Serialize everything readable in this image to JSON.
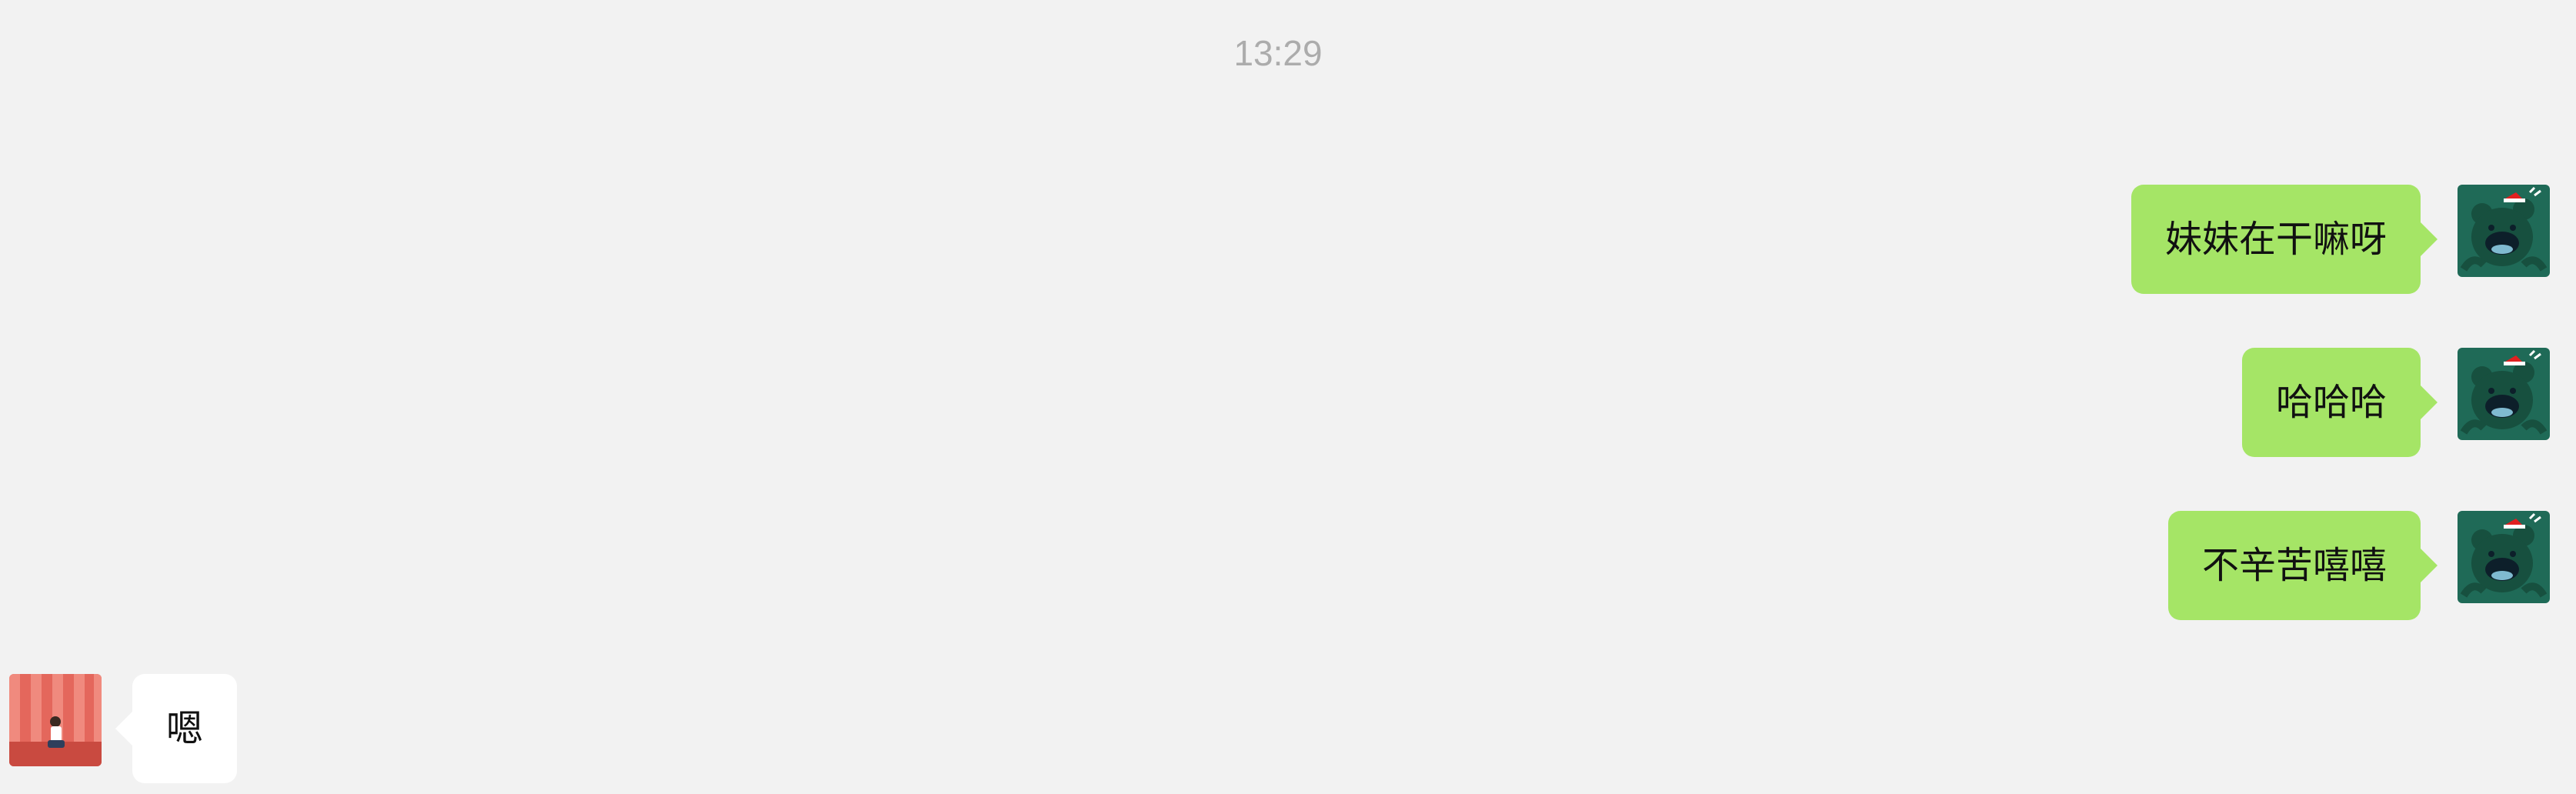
{
  "chat": {
    "timestamp": "13:29",
    "messages": [
      {
        "direction": "outgoing",
        "text": "妹妹在干嘛呀",
        "avatar": "green-bear-avatar"
      },
      {
        "direction": "outgoing",
        "text": "哈哈哈",
        "avatar": "green-bear-avatar"
      },
      {
        "direction": "outgoing",
        "text": "不辛苦嘻嘻",
        "avatar": "green-bear-avatar"
      },
      {
        "direction": "incoming",
        "text": "嗯",
        "avatar": "red-striped-photo-avatar"
      }
    ]
  },
  "colors": {
    "background": "#f2f2f2",
    "outgoing_bubble": "#a5e566",
    "incoming_bubble": "#ffffff",
    "timestamp_text": "#acacac",
    "message_text": "#111111",
    "avatar_bear_bg": "#1f6a57",
    "avatar_photo_bg": "#e4675c"
  }
}
